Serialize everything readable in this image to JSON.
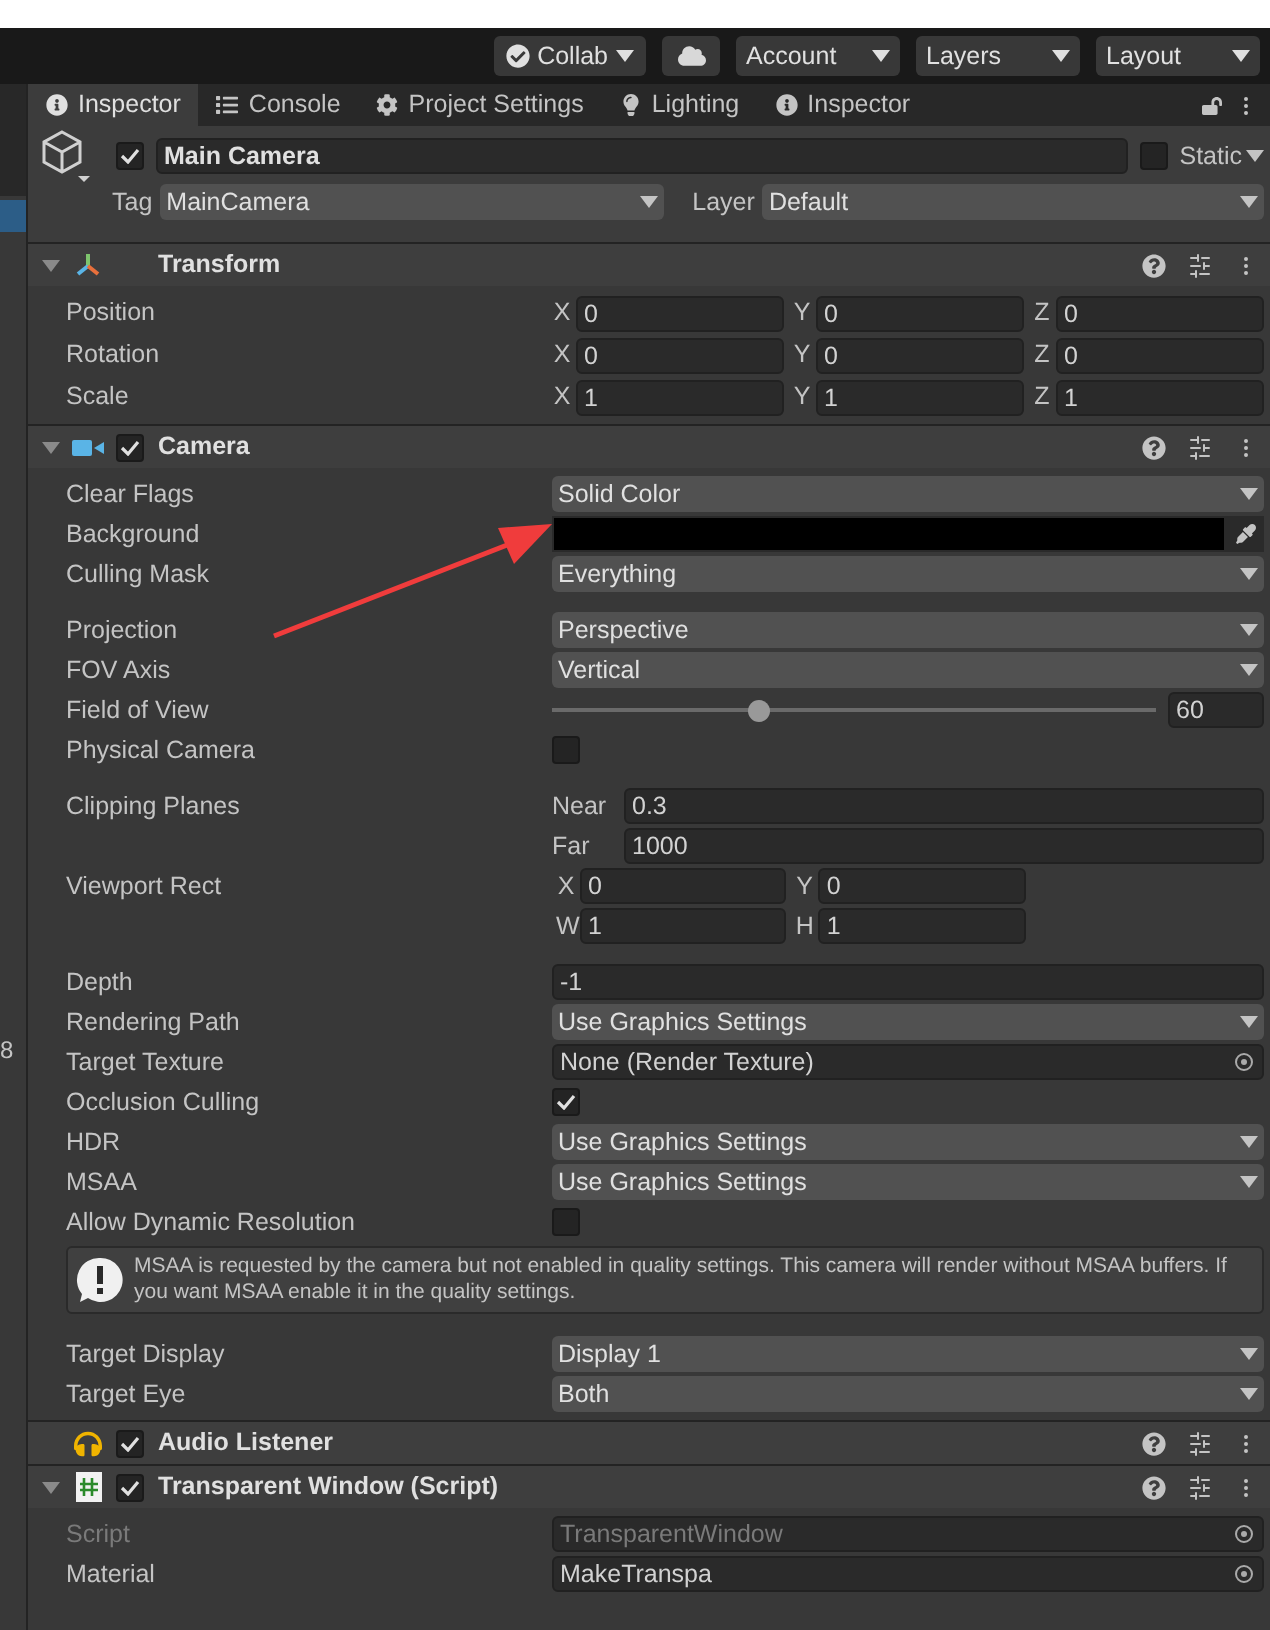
{
  "toolbar": [
    {
      "kind": "collab",
      "label": "Collab"
    },
    {
      "kind": "cloud"
    },
    {
      "kind": "dropdown",
      "label": "Account"
    },
    {
      "kind": "dropdown",
      "label": "Layers"
    },
    {
      "kind": "dropdown",
      "label": "Layout"
    }
  ],
  "side_panel": {
    "text": "8"
  },
  "tabs": [
    {
      "label": "Inspector",
      "selected": true
    },
    {
      "label": "Console",
      "selected": false
    },
    {
      "label": "Project Settings",
      "selected": false
    },
    {
      "label": "Lighting",
      "selected": false
    },
    {
      "label": "Inspector",
      "selected": false
    }
  ],
  "object": {
    "name": "Main Camera",
    "active": true,
    "static": false,
    "static_label": "Static",
    "tag_label": "Tag",
    "tag": "MainCamera",
    "layer_label": "Layer",
    "layer": "Default"
  },
  "components": [
    {
      "title": "Transform",
      "expanded": true,
      "rows": [
        {
          "kind": "vector",
          "label": "Position",
          "fields": [
            {
              "axis": "X",
              "value": "0"
            },
            {
              "axis": "Y",
              "value": "0"
            },
            {
              "axis": "Z",
              "value": "0"
            }
          ]
        },
        {
          "kind": "vector",
          "label": "Rotation",
          "fields": [
            {
              "axis": "X",
              "value": "0"
            },
            {
              "axis": "Y",
              "value": "0"
            },
            {
              "axis": "Z",
              "value": "0"
            }
          ]
        },
        {
          "kind": "vector",
          "label": "Scale",
          "fields": [
            {
              "axis": "X",
              "value": "1"
            },
            {
              "axis": "Y",
              "value": "1"
            },
            {
              "axis": "Z",
              "value": "1"
            }
          ]
        }
      ]
    },
    {
      "title": "Camera",
      "enabled": true,
      "expanded": true,
      "rows": [
        {
          "kind": "dropdown",
          "label": "Clear Flags",
          "value": "Solid Color"
        },
        {
          "kind": "color",
          "label": "Background",
          "color": "#000000"
        },
        {
          "kind": "dropdown",
          "label": "Culling Mask",
          "value": "Everything"
        },
        {
          "kind": "gap"
        },
        {
          "kind": "dropdown",
          "label": "Projection",
          "value": "Perspective"
        },
        {
          "kind": "dropdown",
          "label": "FOV Axis",
          "value": "Vertical"
        },
        {
          "kind": "slider",
          "label": "Field of View",
          "level": 0.34,
          "value": "60"
        },
        {
          "kind": "checkbox",
          "label": "Physical Camera",
          "checked": false
        },
        {
          "kind": "gap"
        },
        {
          "kind": "stacked",
          "label": "Clipping Planes",
          "fields": [
            {
              "axis": "Near",
              "value": "0.3"
            },
            {
              "axis": "Far",
              "value": "1000"
            }
          ]
        },
        {
          "kind": "grid",
          "label": "Viewport Rect",
          "fields": [
            {
              "axis": "X",
              "value": "0"
            },
            {
              "axis": "Y",
              "value": "0"
            },
            {
              "axis": "W",
              "value": "1"
            },
            {
              "axis": "H",
              "value": "1"
            }
          ]
        },
        {
          "kind": "gap"
        },
        {
          "kind": "field",
          "label": "Depth",
          "value": "-1"
        },
        {
          "kind": "dropdown",
          "label": "Rendering Path",
          "value": "Use Graphics Settings"
        },
        {
          "kind": "object",
          "label": "Target Texture",
          "value": "None (Render Texture)",
          "disabled": false
        },
        {
          "kind": "checkbox",
          "label": "Occlusion Culling",
          "checked": true
        },
        {
          "kind": "dropdown",
          "label": "HDR",
          "value": "Use Graphics Settings"
        },
        {
          "kind": "dropdown",
          "label": "MSAA",
          "value": "Use Graphics Settings"
        },
        {
          "kind": "checkbox",
          "label": "Allow Dynamic Resolution",
          "checked": false
        },
        {
          "kind": "help",
          "text": "MSAA is requested by the camera but not enabled in quality settings. This camera will render without MSAA buffers. If you want MSAA enable it in the quality settings."
        },
        {
          "kind": "gap"
        },
        {
          "kind": "dropdown",
          "label": "Target Display",
          "value": "Display 1"
        },
        {
          "kind": "dropdown",
          "label": "Target Eye",
          "value": "Both"
        }
      ]
    },
    {
      "title": "Audio Listener",
      "enabled": true,
      "expanded": false
    },
    {
      "title": "Transparent Window (Script)",
      "enabled": true,
      "expanded": true,
      "rows": [
        {
          "kind": "object",
          "label": "Script",
          "value": "TransparentWindow",
          "disabled": true
        },
        {
          "kind": "object",
          "label": "Material",
          "value": "MakeTranspa",
          "disabled": false
        }
      ]
    }
  ]
}
